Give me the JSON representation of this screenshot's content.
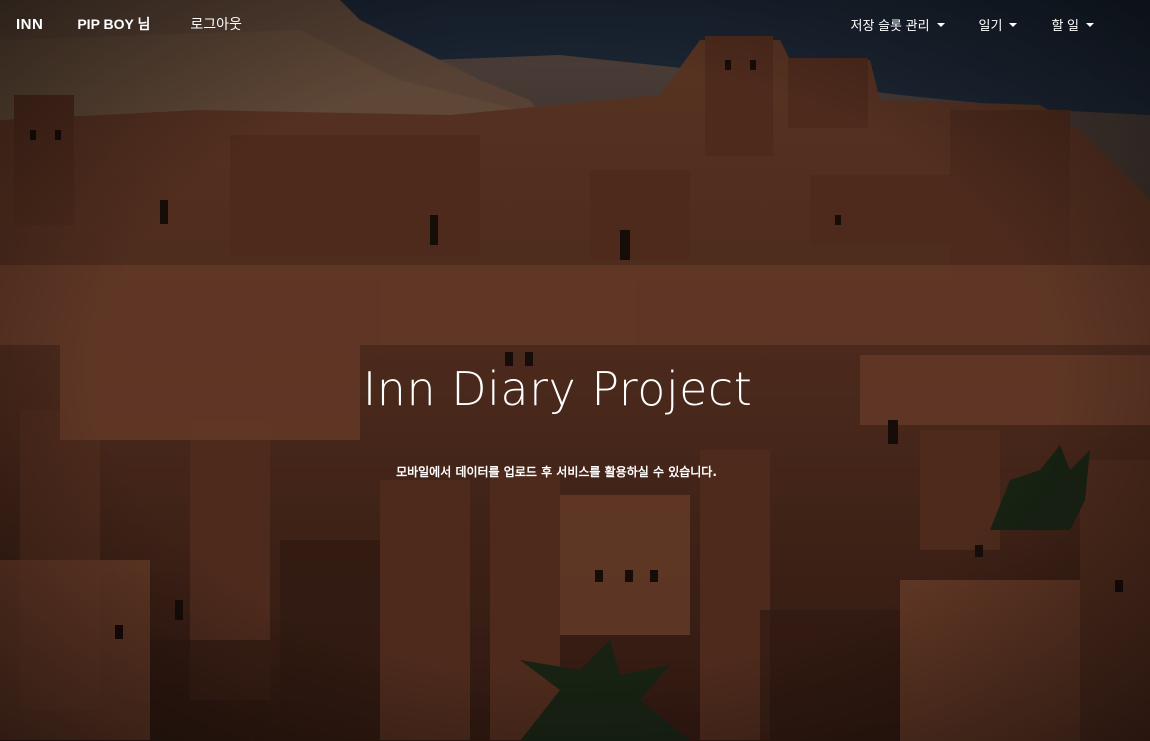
{
  "nav": {
    "brand": "INN",
    "user": "PIP BOY 님",
    "logout": "로그아웃",
    "menus": [
      {
        "label": "저장 슬롯 관리"
      },
      {
        "label": "일기"
      },
      {
        "label": "할 일"
      }
    ]
  },
  "hero": {
    "title": "Inn Diary Project",
    "subtitle": "모바일에서 데이터를 업로드 후 서비스를 활용하실 수 있습니다."
  },
  "colors": {
    "sky": "#2a3546",
    "mud_wall": "#6e3f2a",
    "shadow": "#2b1811",
    "text": "#ffffff"
  }
}
